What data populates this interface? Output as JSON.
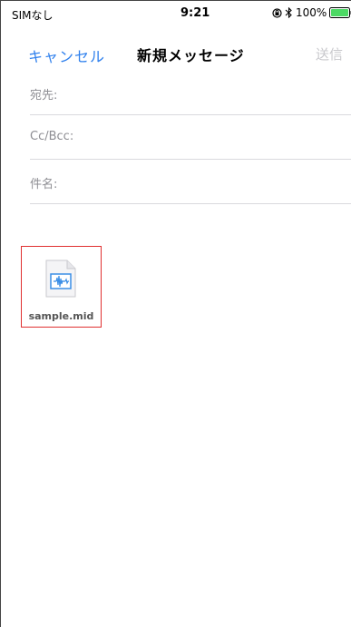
{
  "status_bar": {
    "carrier": "SIMなし",
    "time": "9:21",
    "battery": "100%"
  },
  "nav": {
    "cancel_label": "キャンセル",
    "title": "新規メッセージ",
    "send_label": "送信"
  },
  "fields": {
    "to_label": "宛先:",
    "to_value": "",
    "ccbcc_label": "Cc/Bcc:",
    "ccbcc_value": "",
    "subject_label": "件名:",
    "subject_value": ""
  },
  "attachment": {
    "file_name": "sample.mid",
    "icon": "audio-file-icon"
  },
  "colors": {
    "accent": "#2f80ed",
    "disabled": "#c8c8cc",
    "battery": "#4cd964",
    "highlight_border": "#e03030"
  }
}
